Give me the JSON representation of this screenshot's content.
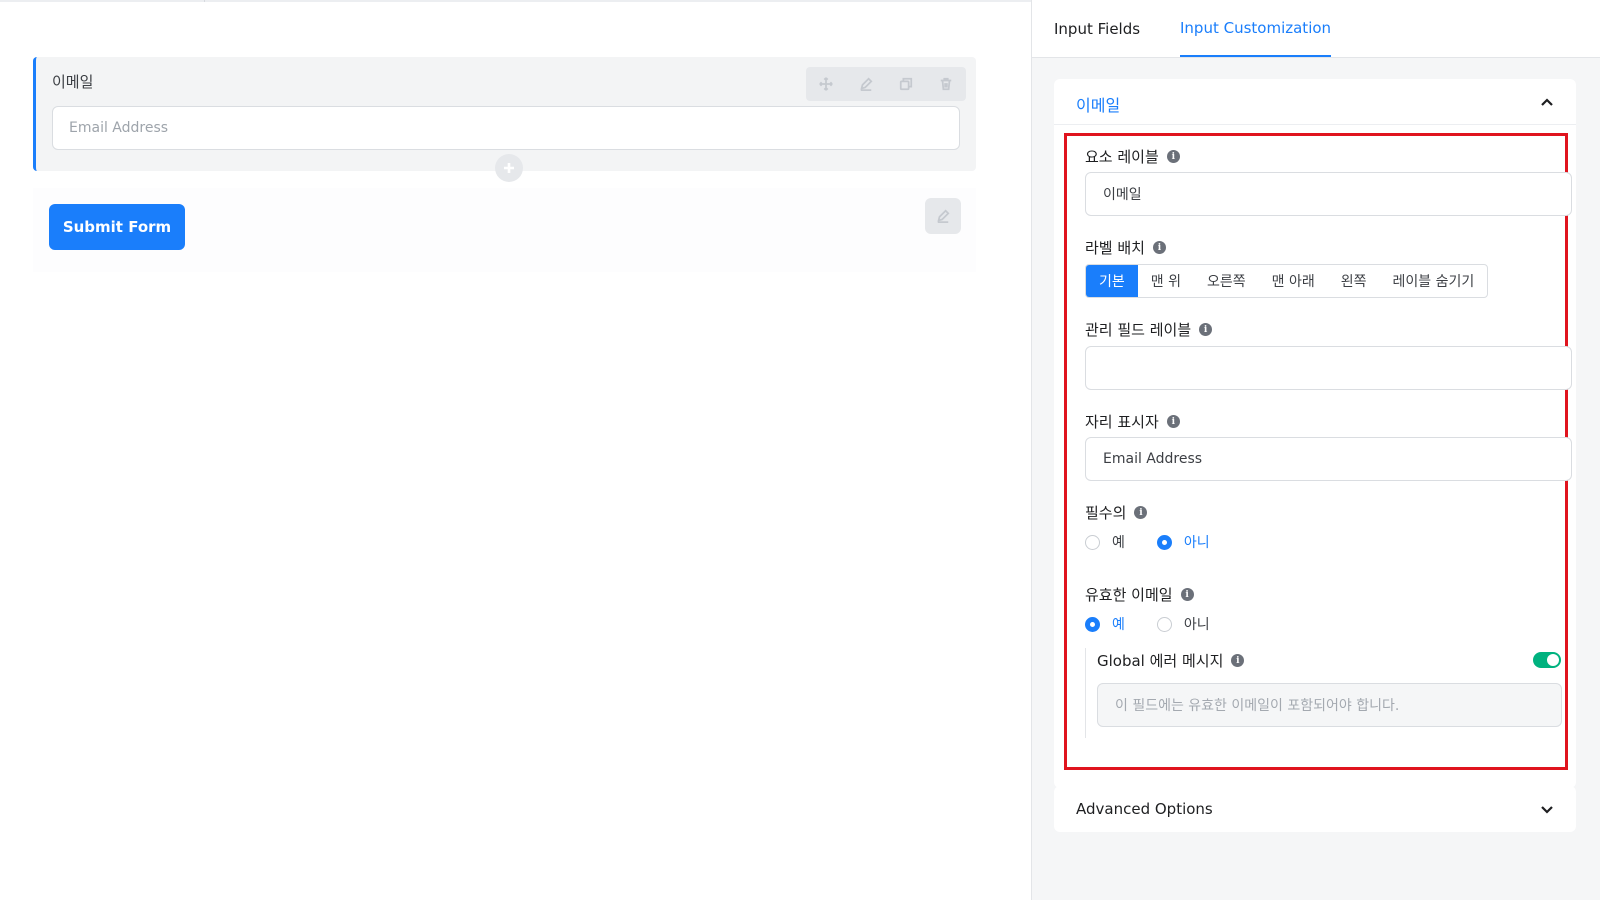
{
  "canvas": {
    "field": {
      "label": "이메일",
      "placeholder": "Email Address",
      "tools": [
        "move-icon",
        "edit-icon",
        "copy-icon",
        "trash-icon"
      ]
    },
    "submit_label": "Submit Form"
  },
  "sidebar": {
    "tabs": [
      {
        "label": "Input Fields",
        "active": false
      },
      {
        "label": "Input Customization",
        "active": true
      }
    ],
    "panel": {
      "title": "이메일",
      "element_label": {
        "label": "요소 레이블",
        "value": "이메일"
      },
      "label_placement": {
        "label": "라벨 배치",
        "options": [
          "기본",
          "맨 위",
          "오른쪽",
          "맨 아래",
          "왼쪽",
          "레이블 숨기기"
        ],
        "selected": "기본"
      },
      "admin_label": {
        "label": "관리 필드 레이블",
        "value": ""
      },
      "placeholder": {
        "label": "자리 표시자",
        "value": "Email Address"
      },
      "required": {
        "label": "필수의",
        "options": [
          "예",
          "아니"
        ],
        "selected": "아니"
      },
      "valid_email": {
        "label": "유효한 이메일",
        "options": [
          "예",
          "아니"
        ],
        "selected": "예"
      },
      "global_error": {
        "label": "Global 에러 메시지",
        "enabled": true,
        "placeholder": "이 필드에는 유효한 이메일이 포함되어야 합니다."
      }
    },
    "advanced_label": "Advanced Options"
  },
  "colors": {
    "accent": "#1a7efb",
    "toggle_on": "#00b27f",
    "highlight_border": "#e0141e"
  }
}
